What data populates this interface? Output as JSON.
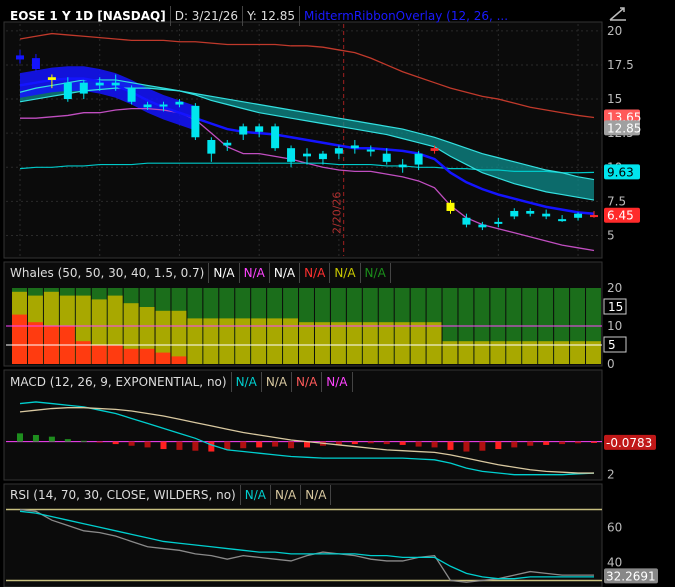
{
  "colors": {
    "bg": "#000000",
    "plot_bg": "#0b0b0b",
    "grid": "#2b2b2b",
    "up": "#00e5ee",
    "down": "#00e5ee",
    "yellow": "#ffff00",
    "red": "#ff2a2a",
    "blue": "#1414ff",
    "ribbon": "#0d8c8c",
    "upper_env": "#c0392b",
    "lower_env": "#c04ec0",
    "lower_band": "#00c8c8",
    "whale_dark": "#1b6e1b",
    "whale_olive": "#a8a800",
    "whale_red": "#ff3b10",
    "macd_line": "#00cfcf",
    "macd_signal": "#d8c8a0",
    "rsi_line": "#8a8a8a",
    "rsi_ema": "#00cfcf",
    "level_line": "#c8c080",
    "magenta": "#ff44ff"
  },
  "header": {
    "symbol": "EOSE 1 Y 1D [NASDAQ]",
    "date": "D: 3/21/26",
    "y_value": "Y: 12.85",
    "study": "MidtermRibbonOverlay (12, 26, ..."
  },
  "price_panel": {
    "y_ticks": [
      "20",
      "17.5",
      "15",
      "12.5",
      "10",
      "7.5",
      "5"
    ],
    "markers": [
      {
        "text": "13.65",
        "color": "#ff5a5a"
      },
      {
        "text": "12.85",
        "color": "#a0a0a0"
      },
      {
        "text": "9.63",
        "color": "#00e5ee"
      },
      {
        "text": "6.45",
        "color": "#ff2a2a"
      }
    ],
    "date_marker": "2/20/26"
  },
  "whales_panel": {
    "title": "Whales (50, 50, 30, 40, 1.5, 0.7)",
    "values": [
      {
        "text": "N/A",
        "color": "#ffffff"
      },
      {
        "text": "N/A",
        "color": "#ff44ff"
      },
      {
        "text": "N/A",
        "color": "#ffffff"
      },
      {
        "text": "N/A",
        "color": "#ff3030"
      },
      {
        "text": "N/A",
        "color": "#c8c800"
      },
      {
        "text": "N/A",
        "color": "#1b8e1b"
      }
    ],
    "y_ticks": [
      "20",
      "10",
      "0"
    ],
    "markers": [
      "15",
      "5"
    ]
  },
  "macd_panel": {
    "title": "MACD (12, 26, 9, EXPONENTIAL, no)",
    "values": [
      {
        "text": "N/A",
        "color": "#00cfcf"
      },
      {
        "text": "N/A",
        "color": "#d8c8a0"
      },
      {
        "text": "N/A",
        "color": "#ff5a5a"
      },
      {
        "text": "N/A",
        "color": "#ff44ff"
      }
    ],
    "y_ticks": [
      "2"
    ],
    "marker": "-0.0783"
  },
  "rsi_panel": {
    "title": "RSI (14, 70, 30, CLOSE, WILDERS, no)",
    "values": [
      {
        "text": "N/A",
        "color": "#00cfcf"
      },
      {
        "text": "N/A",
        "color": "#d8c8a0"
      },
      {
        "text": "N/A",
        "color": "#d8c8a0"
      }
    ],
    "y_ticks": [
      "60",
      "40"
    ],
    "marker": "32.2691"
  },
  "chart_data": [
    {
      "type": "candlestick",
      "ylim": [
        3.5,
        20.5
      ],
      "candles": [
        {
          "o": 18.2,
          "h": 18.6,
          "l": 17.6,
          "c": 17.9,
          "col": "blue"
        },
        {
          "o": 18.0,
          "h": 18.3,
          "l": 17.0,
          "c": 17.2,
          "col": "blue"
        },
        {
          "o": 16.4,
          "h": 16.8,
          "l": 15.8,
          "c": 16.6,
          "col": "yellow"
        },
        {
          "o": 16.2,
          "h": 16.6,
          "l": 14.8,
          "c": 15.0,
          "col": "cyan"
        },
        {
          "o": 15.4,
          "h": 16.4,
          "l": 15.0,
          "c": 16.2,
          "col": "cyan"
        },
        {
          "o": 16.0,
          "h": 16.6,
          "l": 15.6,
          "c": 16.2,
          "col": "cyan"
        },
        {
          "o": 16.2,
          "h": 16.8,
          "l": 15.6,
          "c": 16.0,
          "col": "cyan"
        },
        {
          "o": 15.8,
          "h": 16.0,
          "l": 14.6,
          "c": 14.8,
          "col": "cyan"
        },
        {
          "o": 14.6,
          "h": 14.8,
          "l": 14.2,
          "c": 14.4,
          "col": "cyan"
        },
        {
          "o": 14.5,
          "h": 14.8,
          "l": 14.1,
          "c": 14.6,
          "col": "cyan"
        },
        {
          "o": 14.6,
          "h": 15.0,
          "l": 14.4,
          "c": 14.8,
          "col": "cyan"
        },
        {
          "o": 14.5,
          "h": 14.7,
          "l": 12.0,
          "c": 12.2,
          "col": "cyan"
        },
        {
          "o": 12.0,
          "h": 12.2,
          "l": 10.4,
          "c": 11.0,
          "col": "cyan"
        },
        {
          "o": 11.6,
          "h": 12.0,
          "l": 11.2,
          "c": 11.8,
          "col": "cyan"
        },
        {
          "o": 12.4,
          "h": 13.2,
          "l": 12.0,
          "c": 13.0,
          "col": "cyan"
        },
        {
          "o": 12.6,
          "h": 13.2,
          "l": 12.2,
          "c": 13.0,
          "col": "cyan"
        },
        {
          "o": 13.0,
          "h": 13.2,
          "l": 11.2,
          "c": 11.4,
          "col": "cyan"
        },
        {
          "o": 11.4,
          "h": 11.6,
          "l": 10.0,
          "c": 10.4,
          "col": "cyan"
        },
        {
          "o": 10.8,
          "h": 11.4,
          "l": 10.2,
          "c": 11.0,
          "col": "cyan"
        },
        {
          "o": 10.6,
          "h": 11.2,
          "l": 10.2,
          "c": 11.0,
          "col": "cyan"
        },
        {
          "o": 11.0,
          "h": 11.6,
          "l": 10.6,
          "c": 11.4,
          "col": "cyan"
        },
        {
          "o": 11.4,
          "h": 12.0,
          "l": 11.0,
          "c": 11.6,
          "col": "cyan"
        },
        {
          "o": 11.2,
          "h": 11.6,
          "l": 10.8,
          "c": 11.3,
          "col": "cyan"
        },
        {
          "o": 11.0,
          "h": 11.4,
          "l": 10.2,
          "c": 10.4,
          "col": "cyan"
        },
        {
          "o": 10.0,
          "h": 10.6,
          "l": 9.6,
          "c": 10.2,
          "col": "cyan"
        },
        {
          "o": 10.2,
          "h": 11.2,
          "l": 9.8,
          "c": 11.0,
          "col": "cyan"
        },
        {
          "o": 11.4,
          "h": 11.6,
          "l": 11.0,
          "c": 11.2,
          "col": "red"
        },
        {
          "o": 7.4,
          "h": 7.6,
          "l": 6.6,
          "c": 6.8,
          "col": "yellow"
        },
        {
          "o": 6.3,
          "h": 6.6,
          "l": 5.6,
          "c": 5.8,
          "col": "cyan"
        },
        {
          "o": 5.8,
          "h": 6.0,
          "l": 5.4,
          "c": 5.6,
          "col": "cyan"
        },
        {
          "o": 6.0,
          "h": 6.3,
          "l": 5.6,
          "c": 5.9,
          "col": "cyan"
        },
        {
          "o": 6.4,
          "h": 7.0,
          "l": 6.2,
          "c": 6.8,
          "col": "cyan"
        },
        {
          "o": 6.6,
          "h": 7.0,
          "l": 6.4,
          "c": 6.8,
          "col": "cyan"
        },
        {
          "o": 6.6,
          "h": 6.9,
          "l": 6.2,
          "c": 6.4,
          "col": "cyan"
        },
        {
          "o": 6.2,
          "h": 6.5,
          "l": 6.0,
          "c": 6.2,
          "col": "cyan"
        },
        {
          "o": 6.3,
          "h": 6.7,
          "l": 6.1,
          "c": 6.6,
          "col": "cyan"
        },
        {
          "o": 6.5,
          "h": 6.8,
          "l": 6.3,
          "c": 6.45,
          "col": "red"
        }
      ],
      "upper_envelope": [
        19.4,
        19.6,
        19.8,
        19.7,
        19.6,
        19.5,
        19.4,
        19.3,
        19.3,
        19.3,
        19.2,
        19.2,
        19.1,
        19.0,
        19.0,
        19.0,
        19.0,
        18.9,
        18.9,
        18.8,
        18.6,
        18.4,
        18.0,
        17.5,
        17.0,
        16.6,
        16.2,
        15.8,
        15.5,
        15.2,
        15.0,
        14.7,
        14.4,
        14.2,
        14.0,
        13.8,
        13.65
      ],
      "lower_envelope": [
        13.6,
        13.6,
        13.7,
        13.8,
        14.0,
        14.0,
        14.2,
        14.3,
        14.3,
        14.2,
        14.0,
        13.5,
        12.5,
        11.5,
        11.0,
        11.0,
        10.8,
        10.6,
        10.3,
        10.0,
        9.8,
        9.7,
        9.7,
        9.5,
        9.3,
        9.0,
        8.5,
        7.2,
        6.3,
        5.8,
        5.5,
        5.2,
        4.9,
        4.6,
        4.3,
        4.1,
        3.9
      ],
      "lower_band": [
        9.9,
        10.0,
        10.0,
        10.1,
        10.1,
        10.2,
        10.2,
        10.2,
        10.3,
        10.3,
        10.3,
        10.3,
        10.3,
        10.3,
        10.3,
        10.3,
        10.3,
        10.3,
        10.3,
        10.3,
        10.2,
        10.2,
        10.2,
        10.1,
        10.1,
        10.0,
        10.0,
        9.9,
        9.9,
        9.8,
        9.8,
        9.7,
        9.7,
        9.7,
        9.6,
        9.6,
        9.63
      ],
      "fast_ma": [
        15.5,
        15.8,
        16.0,
        16.2,
        16.4,
        16.4,
        16.4,
        16.2,
        16.0,
        15.8,
        15.6,
        15.3,
        14.9,
        14.6,
        14.3,
        14.0,
        13.8,
        13.6,
        13.4,
        13.2,
        13.0,
        12.8,
        12.6,
        12.4,
        12.1,
        11.8,
        11.5,
        10.8,
        10.2,
        9.6,
        9.2,
        8.8,
        8.5,
        8.2,
        8.0,
        7.8,
        7.6
      ],
      "slow_ma": [
        14.8,
        15.0,
        15.2,
        15.4,
        15.6,
        15.7,
        15.8,
        15.8,
        15.8,
        15.7,
        15.6,
        15.4,
        15.2,
        15.0,
        14.8,
        14.6,
        14.4,
        14.2,
        14.0,
        13.8,
        13.6,
        13.4,
        13.2,
        13.0,
        12.8,
        12.5,
        12.2,
        11.8,
        11.4,
        11.0,
        10.7,
        10.4,
        10.1,
        9.8,
        9.6,
        9.3,
        9.1
      ],
      "blue_line": [
        16.0,
        16.2,
        16.4,
        16.5,
        16.5,
        16.3,
        16.0,
        15.5,
        14.9,
        14.4,
        14.0,
        13.6,
        13.2,
        12.8,
        12.6,
        12.5,
        12.4,
        12.2,
        12.0,
        11.8,
        11.6,
        11.4,
        11.4,
        11.3,
        11.2,
        11.0,
        10.6,
        9.6,
        8.9,
        8.4,
        8.0,
        7.7,
        7.4,
        7.1,
        6.9,
        6.7,
        6.6
      ]
    },
    {
      "type": "bar",
      "ylim": [
        0,
        20
      ],
      "dark": [
        20,
        20,
        20,
        20,
        20,
        20,
        20,
        20,
        20,
        20,
        20,
        20,
        20,
        20,
        20,
        20,
        20,
        20,
        20,
        20,
        20,
        20,
        20,
        20,
        20,
        20,
        20,
        20,
        20,
        20,
        20,
        20,
        20,
        20,
        20,
        20,
        20
      ],
      "olive": [
        19,
        18,
        19,
        18,
        18,
        17,
        18,
        16,
        15,
        14,
        14,
        12,
        12,
        12,
        12,
        12,
        12,
        12,
        11,
        11,
        11,
        11,
        11,
        11,
        11,
        11,
        11,
        6,
        6,
        6,
        6,
        6,
        6,
        6,
        6,
        6,
        6
      ],
      "red": [
        13,
        11,
        10,
        10,
        6,
        5,
        5,
        4,
        4,
        3,
        2,
        0,
        0,
        0,
        0,
        0,
        0,
        0,
        0,
        0,
        0,
        0,
        0,
        0,
        0,
        0,
        0,
        0,
        0,
        0,
        0,
        0,
        0,
        0,
        0,
        0,
        0
      ],
      "line_magenta": 10,
      "line_white": 5
    },
    {
      "type": "line",
      "ylim": [
        -2.2,
        3.0
      ],
      "macd": [
        2.3,
        2.4,
        2.3,
        2.2,
        2.1,
        1.9,
        1.7,
        1.4,
        1.1,
        0.8,
        0.5,
        0.2,
        -0.2,
        -0.5,
        -0.6,
        -0.7,
        -0.8,
        -0.9,
        -0.95,
        -1.0,
        -1.0,
        -1.0,
        -1.0,
        -1.0,
        -1.0,
        -1.05,
        -1.1,
        -1.3,
        -1.6,
        -1.8,
        -1.9,
        -2.0,
        -2.0,
        -2.0,
        -2.0,
        -1.95,
        -1.9
      ],
      "signal": [
        1.8,
        1.9,
        2.0,
        2.05,
        2.05,
        2.0,
        1.95,
        1.85,
        1.7,
        1.55,
        1.35,
        1.15,
        0.95,
        0.75,
        0.55,
        0.4,
        0.25,
        0.1,
        0.0,
        -0.1,
        -0.2,
        -0.3,
        -0.4,
        -0.5,
        -0.55,
        -0.6,
        -0.65,
        -0.8,
        -1.0,
        -1.2,
        -1.4,
        -1.55,
        -1.7,
        -1.8,
        -1.85,
        -1.9,
        -1.9
      ],
      "hist": [
        0.5,
        0.4,
        0.3,
        0.15,
        0.05,
        -0.05,
        -0.15,
        -0.25,
        -0.35,
        -0.45,
        -0.5,
        -0.55,
        -0.6,
        -0.5,
        -0.4,
        -0.35,
        -0.3,
        -0.4,
        -0.35,
        -0.25,
        -0.2,
        -0.15,
        -0.1,
        -0.15,
        -0.2,
        -0.3,
        -0.35,
        -0.5,
        -0.6,
        -0.55,
        -0.45,
        -0.35,
        -0.25,
        -0.2,
        -0.15,
        -0.1,
        -0.08
      ]
    },
    {
      "type": "line",
      "ylim": [
        28,
        72
      ],
      "rsi": [
        70,
        69,
        64,
        61,
        58,
        57,
        55,
        52,
        49,
        48,
        47,
        45,
        44,
        42,
        44,
        43,
        42,
        41,
        44,
        46,
        45,
        44,
        42,
        41,
        41,
        43,
        44,
        30,
        29,
        30,
        31,
        33,
        35,
        34,
        33,
        33,
        33
      ],
      "rsi_ema": [
        69,
        68,
        66,
        64,
        62,
        60,
        58,
        56,
        54,
        52,
        51,
        50,
        49,
        48,
        47,
        46,
        46,
        45,
        45,
        45,
        45,
        45,
        44,
        44,
        43,
        43,
        43,
        38,
        34,
        32,
        31,
        31,
        32,
        32,
        32,
        32,
        32
      ],
      "level_high": 70,
      "level_low": 30
    }
  ]
}
